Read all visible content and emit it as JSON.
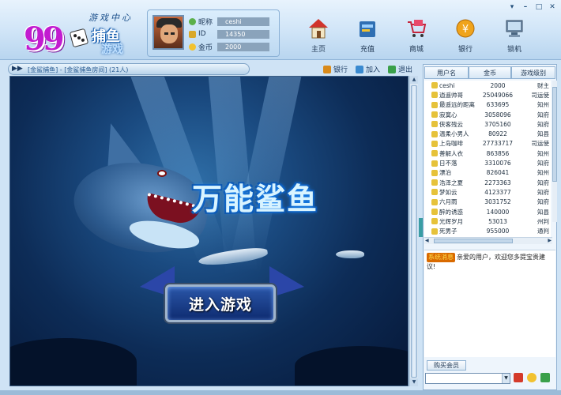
{
  "window": {
    "controls": [
      "▾",
      "–",
      "□",
      "✕"
    ]
  },
  "logo": {
    "numeral": "99",
    "subtitle": "游戏中心",
    "title_line1": "捕鱼",
    "title_line2": "游戏"
  },
  "user": {
    "nickname_label": "昵称",
    "nickname": "ceshi",
    "id_label": "ID",
    "id": "14350",
    "coins_label": "金币",
    "coins": "2000"
  },
  "nav": [
    {
      "label": "主页",
      "icon": "home-icon"
    },
    {
      "label": "充值",
      "icon": "recharge-icon"
    },
    {
      "label": "商城",
      "icon": "shop-cart-icon"
    },
    {
      "label": "银行",
      "icon": "bank-coin-icon"
    },
    {
      "label": "锁机",
      "icon": "lock-computer-icon"
    }
  ],
  "titlebar": {
    "arrow": "▶▶",
    "path": "[金鲨捕鱼] - [金鲨捕鱼房间] (21人)",
    "actions": [
      {
        "label": "银行",
        "icon": "bank-icon",
        "color": "#d98a1a"
      },
      {
        "label": "加入",
        "icon": "join-icon",
        "color": "#3a8ad0"
      },
      {
        "label": "退出",
        "icon": "exit-icon",
        "color": "#3aa04a"
      }
    ]
  },
  "game": {
    "title": "万能鲨鱼",
    "enter_button": "进入游戏"
  },
  "user_list": {
    "columns": [
      "用户名",
      "金币",
      "游戏级别"
    ],
    "rows": [
      {
        "name": "ceshi",
        "coins": "2000",
        "level": "财主",
        "badge": "#e6c23a"
      },
      {
        "name": "逍遥帅哥",
        "coins": "25049066",
        "level": "司运使",
        "badge": "#e6c23a"
      },
      {
        "name": "最遥远的距离",
        "coins": "633695",
        "level": "知州",
        "badge": "#e6c23a"
      },
      {
        "name": "寂寞心",
        "coins": "3058096",
        "level": "知府",
        "badge": "#e6c23a"
      },
      {
        "name": "侠客残云",
        "coins": "3705160",
        "level": "知府",
        "badge": "#e6c23a"
      },
      {
        "name": "温柔小男人",
        "coins": "80922",
        "level": "知县",
        "badge": "#e6c23a"
      },
      {
        "name": "上岛咖啡",
        "coins": "27733717",
        "level": "司运使",
        "badge": "#e6c23a"
      },
      {
        "name": "善解人衣",
        "coins": "863856",
        "level": "知州",
        "badge": "#e6c23a"
      },
      {
        "name": "日不落",
        "coins": "3310076",
        "level": "知府",
        "badge": "#e6c23a"
      },
      {
        "name": "漂泊",
        "coins": "826041",
        "level": "知州",
        "badge": "#e6c23a"
      },
      {
        "name": "浩泽之夏",
        "coins": "2273363",
        "level": "知府",
        "badge": "#e6c23a"
      },
      {
        "name": "梦如云",
        "coins": "4123377",
        "level": "知府",
        "badge": "#e6c23a"
      },
      {
        "name": "六月雨",
        "coins": "3031752",
        "level": "知府",
        "badge": "#e6c23a"
      },
      {
        "name": "醉的诱惑",
        "coins": "140000",
        "level": "知县",
        "badge": "#e6c23a"
      },
      {
        "name": "光辉岁月",
        "coins": "53013",
        "level": "州判",
        "badge": "#e6c23a"
      },
      {
        "name": "死男子",
        "coins": "955000",
        "level": "通判",
        "badge": "#e6c23a"
      }
    ]
  },
  "chat": {
    "tag": "系统消息",
    "message": "亲爱的用户，欢迎您多提宝贵建议!"
  },
  "buy_vip": "购买会员",
  "scroll_arrows": {
    "up": "▲",
    "down": "▼",
    "left": "◀",
    "right": "▶",
    "dropdown": "▼"
  },
  "colors": {
    "accent": "#2b5d93",
    "panel_bg": "#cfe3f5",
    "game_bg": "#0d2c57",
    "button": "#1a3f8c"
  }
}
